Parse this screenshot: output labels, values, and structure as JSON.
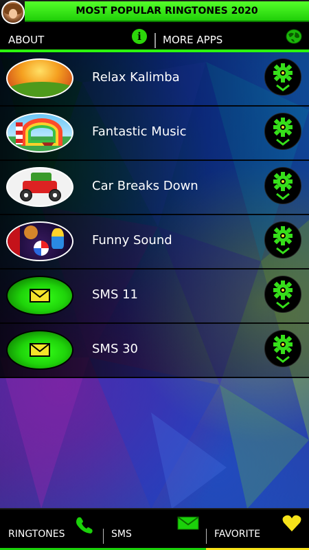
{
  "app": {
    "title": "MOST POPULAR RINGTONES 2020",
    "avatar_icon": "avatar-photo-icon"
  },
  "menu": {
    "about_label": "ABOUT",
    "about_icon": "info-icon",
    "more_apps_label": "MORE APPS",
    "more_apps_icon": "globe-icon"
  },
  "ringtones": [
    {
      "name": "Relax Kalimba",
      "thumbnail": "sunset-landscape-thumbnail",
      "action_icon": "gear-download-icon"
    },
    {
      "name": "Fantastic Music",
      "thumbnail": "lighthouse-rainbow-thumbnail",
      "action_icon": "gear-download-icon"
    },
    {
      "name": "Car Breaks Down",
      "thumbnail": "vintage-car-thumbnail",
      "action_icon": "gear-download-icon"
    },
    {
      "name": "Funny Sound",
      "thumbnail": "circus-clown-thumbnail",
      "action_icon": "gear-download-icon"
    },
    {
      "name": "SMS 11",
      "thumbnail": "envelope-thumbnail",
      "action_icon": "gear-download-icon"
    },
    {
      "name": "SMS 30",
      "thumbnail": "envelope-thumbnail",
      "action_icon": "gear-download-icon"
    }
  ],
  "bottom_nav": {
    "ringtones_label": "RINGTONES",
    "ringtones_icon": "phone-icon",
    "sms_label": "SMS",
    "sms_icon": "envelope-icon",
    "favorite_label": "FAVORITE",
    "favorite_icon": "heart-icon"
  },
  "colors": {
    "accent_green": "#2cff0e",
    "favorite_yellow": "#f7e31a",
    "bar_background": "#000000"
  }
}
